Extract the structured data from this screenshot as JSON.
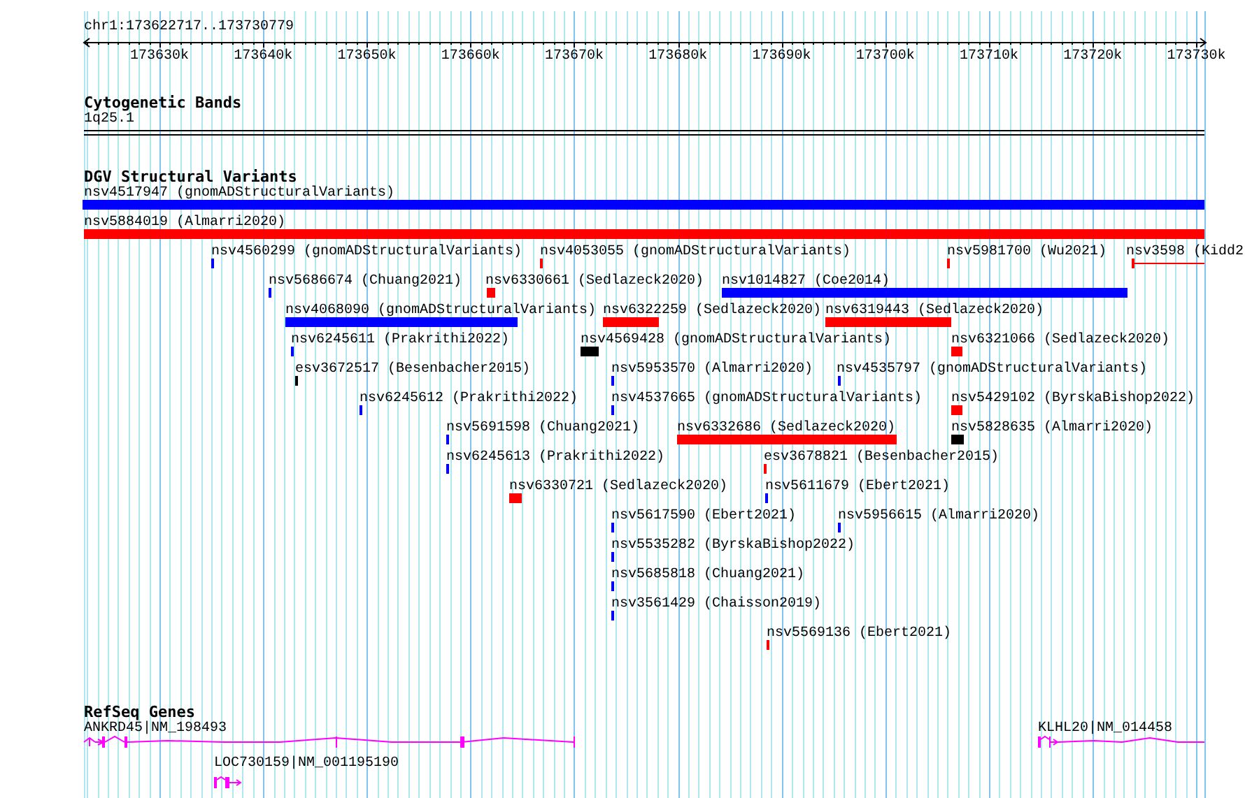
{
  "ruler": {
    "location": "chr1:173622717..173730779",
    "ticks": [
      "173630k",
      "173640k",
      "173650k",
      "173660k",
      "173670k",
      "173680k",
      "173690k",
      "173700k",
      "173710k",
      "173720k",
      "173730k"
    ]
  },
  "cytogenetic_track": {
    "title": "Cytogenetic Bands",
    "band": "1q25.1"
  },
  "dgv_track": {
    "title": "DGV Structural Variants",
    "features": [
      {
        "label": "nsv4517947 (gnomADStructuralVariants)",
        "color": "#0000ff",
        "kind": "bar"
      },
      {
        "label": "nsv5884019 (Almarri2020)",
        "color": "#ff0000",
        "kind": "bar"
      },
      {
        "label": "nsv4560299 (gnomADStructuralVariants)",
        "color": "#0000ff",
        "kind": "bar"
      },
      {
        "label": "nsv4053055 (gnomADStructuralVariants)",
        "color": "#ff0000",
        "kind": "bar"
      },
      {
        "label": "nsv5981700 (Wu2021)",
        "color": "#ff0000",
        "kind": "bar"
      },
      {
        "label": "nsv3598 (Kidd2",
        "color": "#ff0000",
        "kind": "line"
      },
      {
        "label": "nsv5686674 (Chuang2021)",
        "color": "#0000ff",
        "kind": "bar"
      },
      {
        "label": "nsv6330661 (Sedlazeck2020)",
        "color": "#ff0000",
        "kind": "bar"
      },
      {
        "label": "nsv1014827 (Coe2014)",
        "color": "#0000ff",
        "kind": "bar"
      },
      {
        "label": "nsv4068090 (gnomADStructuralVariants)",
        "color": "#0000ff",
        "kind": "bar"
      },
      {
        "label": "nsv6322259 (Sedlazeck2020)",
        "color": "#ff0000",
        "kind": "bar"
      },
      {
        "label": "nsv6319443 (Sedlazeck2020)",
        "color": "#ff0000",
        "kind": "bar"
      },
      {
        "label": "nsv6245611 (Prakrithi2022)",
        "color": "#0000ff",
        "kind": "bar"
      },
      {
        "label": "nsv4569428 (gnomADStructuralVariants)",
        "color": "#000000",
        "kind": "bar"
      },
      {
        "label": "nsv6321066 (Sedlazeck2020)",
        "color": "#ff0000",
        "kind": "bar"
      },
      {
        "label": "esv3672517 (Besenbacher2015)",
        "color": "#000000",
        "kind": "bar"
      },
      {
        "label": "nsv5953570 (Almarri2020)",
        "color": "#0000ff",
        "kind": "bar"
      },
      {
        "label": "nsv4535797 (gnomADStructuralVariants)",
        "color": "#0000ff",
        "kind": "bar"
      },
      {
        "label": "nsv6245612 (Prakrithi2022)",
        "color": "#0000ff",
        "kind": "bar"
      },
      {
        "label": "nsv4537665 (gnomADStructuralVariants)",
        "color": "#0000ff",
        "kind": "bar"
      },
      {
        "label": "nsv5429102 (ByrskaBishop2022)",
        "color": "#ff0000",
        "kind": "bar"
      },
      {
        "label": "nsv5691598 (Chuang2021)",
        "color": "#0000ff",
        "kind": "bar"
      },
      {
        "label": "nsv6332686 (Sedlazeck2020)",
        "color": "#ff0000",
        "kind": "bar"
      },
      {
        "label": "nsv5828635 (Almarri2020)",
        "color": "#000000",
        "kind": "bar"
      },
      {
        "label": "nsv6245613 (Prakrithi2022)",
        "color": "#0000ff",
        "kind": "bar"
      },
      {
        "label": "esv3678821 (Besenbacher2015)",
        "color": "#ff0000",
        "kind": "bar"
      },
      {
        "label": "nsv6330721 (Sedlazeck2020)",
        "color": "#ff0000",
        "kind": "bar"
      },
      {
        "label": "nsv5611679 (Ebert2021)",
        "color": "#0000ff",
        "kind": "bar"
      },
      {
        "label": "nsv5617590 (Ebert2021)",
        "color": "#0000ff",
        "kind": "bar"
      },
      {
        "label": "nsv5956615 (Almarri2020)",
        "color": "#0000ff",
        "kind": "bar"
      },
      {
        "label": "nsv5535282 (ByrskaBishop2022)",
        "color": "#0000ff",
        "kind": "bar"
      },
      {
        "label": "nsv5685818 (Chuang2021)",
        "color": "#0000ff",
        "kind": "bar"
      },
      {
        "label": "nsv3561429 (Chaisson2019)",
        "color": "#0000ff",
        "kind": "bar"
      },
      {
        "label": "nsv5569136 (Ebert2021)",
        "color": "#ff0000",
        "kind": "bar"
      }
    ]
  },
  "refseq_track": {
    "title": "RefSeq Genes",
    "genes": [
      {
        "label": "ANKRD45|NM_198493"
      },
      {
        "label": "LOC730159|NM_001195190"
      },
      {
        "label": "KLHL20|NM_014458"
      }
    ]
  }
}
